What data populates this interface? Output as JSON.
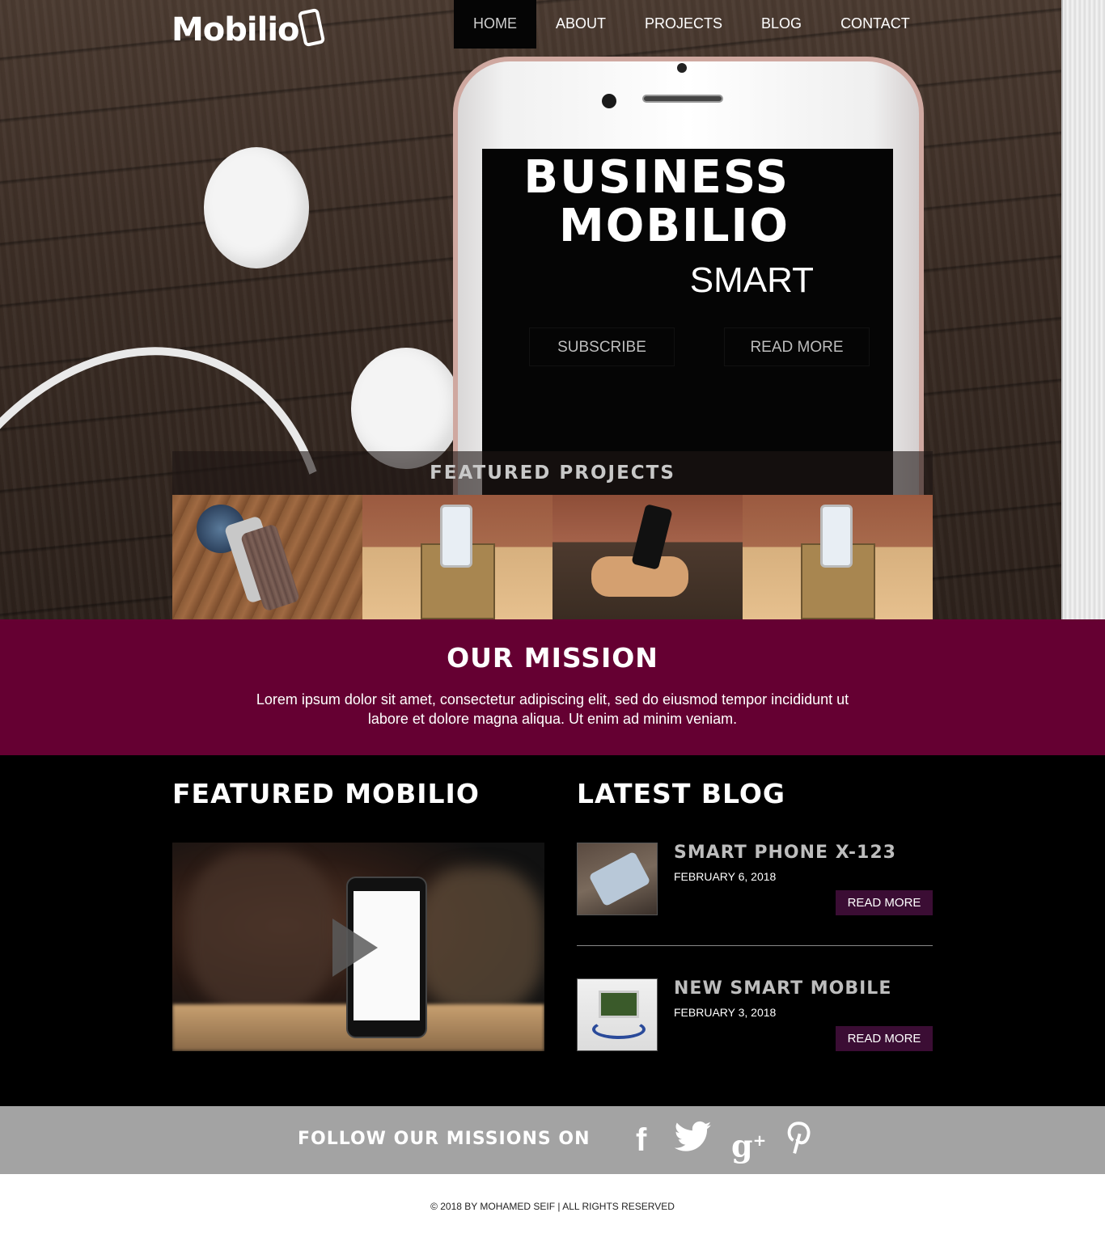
{
  "brand": {
    "logo_text": "Mobilio"
  },
  "nav": {
    "items": [
      "HOME",
      "ABOUT",
      "PROJECTS",
      "BLOG",
      "CONTACT"
    ],
    "active": "HOME"
  },
  "hero": {
    "title_line1": "BUSINESS",
    "title_line2": "MOBILIO",
    "subtitle": "SMART",
    "subscribe_label": "SUBSCRIBE",
    "read_more_label": "READ MORE"
  },
  "featured_projects": {
    "title": "FEATURED PROJECTS"
  },
  "mission": {
    "title": "OUR MISSION",
    "text": "Lorem ipsum dolor sit amet, consectetur adipiscing elit, sed do eiusmod tempor incididunt ut labore et dolore magna aliqua. Ut enim ad minim veniam."
  },
  "featured_mobilio": {
    "title": "FEATURED MOBILIO"
  },
  "blog": {
    "title": "LATEST BLOG",
    "posts": [
      {
        "title": "SMART PHONE X-123",
        "date": "FEBRUARY 6, 2018",
        "button": "READ MORE"
      },
      {
        "title": "NEW SMART MOBILE",
        "date": "FEBRUARY 3, 2018",
        "button": "READ MORE"
      }
    ]
  },
  "follow": {
    "label": "FOLLOW OUR MISSIONS ON",
    "icons": [
      "facebook-icon",
      "twitter-icon",
      "google-plus-icon",
      "pinterest-icon"
    ]
  },
  "footer": {
    "copyright": "© 2018 BY MOHAMED SEIF | ALL RIGHTS RESERVED"
  },
  "colors": {
    "mission_bg": "#650032",
    "blog_button": "#3b0d34",
    "follow_bg": "#a3a3a3"
  }
}
